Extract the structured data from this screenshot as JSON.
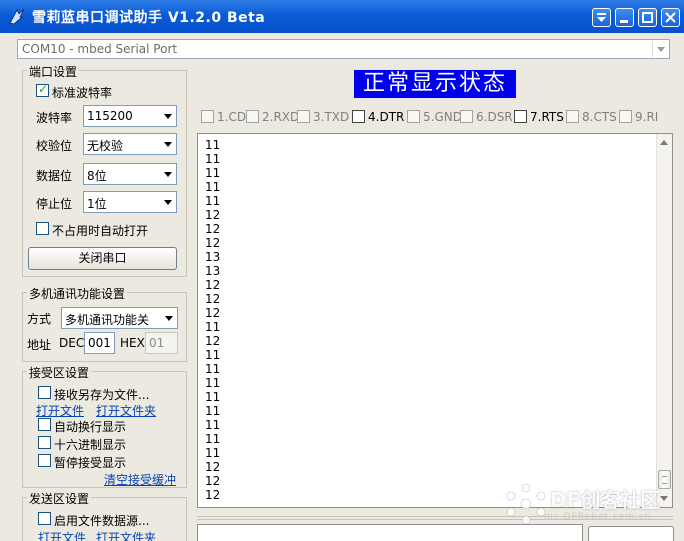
{
  "window": {
    "title": "雪莉蓝串口调试助手 V1.2.0 Beta",
    "controls": [
      "dropdown-icon",
      "minimize-icon",
      "maximize-icon",
      "close-icon"
    ]
  },
  "port_selector": {
    "value": "COM10 - mbed Serial Port"
  },
  "port_settings": {
    "title": "端口设置",
    "standard_baud_label": "标准波特率",
    "standard_baud_checked": true,
    "baud_label": "波特率",
    "baud_value": "115200",
    "parity_label": "校验位",
    "parity_value": "无校验",
    "databits_label": "数据位",
    "databits_value": "8位",
    "stopbits_label": "停止位",
    "stopbits_value": "1位",
    "auto_open_label": "不占用时自动打开",
    "auto_open_checked": false,
    "close_port_label": "关闭串口"
  },
  "multi": {
    "title": "多机通讯功能设置",
    "mode_label": "方式",
    "mode_value": "多机通讯功能关",
    "addr_label": "地址",
    "dec_label": "DEC",
    "dec_value": "001",
    "hex_label": "HEX",
    "hex_value": "01"
  },
  "receive": {
    "title": "接受区设置",
    "save_to_file_label": "接收另存为文件...",
    "open_file_link": "打开文件",
    "open_folder_link": "打开文件夹",
    "auto_newline_label": "自动换行显示",
    "hex_display_label": "十六进制显示",
    "pause_label": "暂停接受显示",
    "clear_link": "清空接受缓冲"
  },
  "send": {
    "title": "发送区设置",
    "file_source_label": "启用文件数据源...",
    "open_file_link": "打开文件",
    "open_folder_link": "打开文件夹"
  },
  "status_banner": "正常显示状态",
  "signals": [
    {
      "label": "1.CD",
      "on": false
    },
    {
      "label": "2.RXD",
      "on": false
    },
    {
      "label": "3.TXD",
      "on": false
    },
    {
      "label": "4.DTR",
      "on": true
    },
    {
      "label": "5.GND",
      "on": false
    },
    {
      "label": "6.DSR",
      "on": false
    },
    {
      "label": "7.RTS",
      "on": true
    },
    {
      "label": "8.CTS",
      "on": false
    },
    {
      "label": "9.RI",
      "on": false
    }
  ],
  "received_lines": [
    "11",
    "11",
    "11",
    "11",
    "11",
    "12",
    "12",
    "12",
    "13",
    "13",
    "12",
    "12",
    "12",
    "11",
    "12",
    "11",
    "11",
    "11",
    "11",
    "11",
    "11",
    "11",
    "11",
    "12",
    "12",
    "12"
  ],
  "watermark": {
    "text": "DF创客社区",
    "sub": "mc.DFRobot.com.cn"
  },
  "colors": {
    "titlebar": "#0a5bd8",
    "banner": "#0000ee",
    "link": "#0645ad",
    "window_bg": "#ece9e0"
  }
}
